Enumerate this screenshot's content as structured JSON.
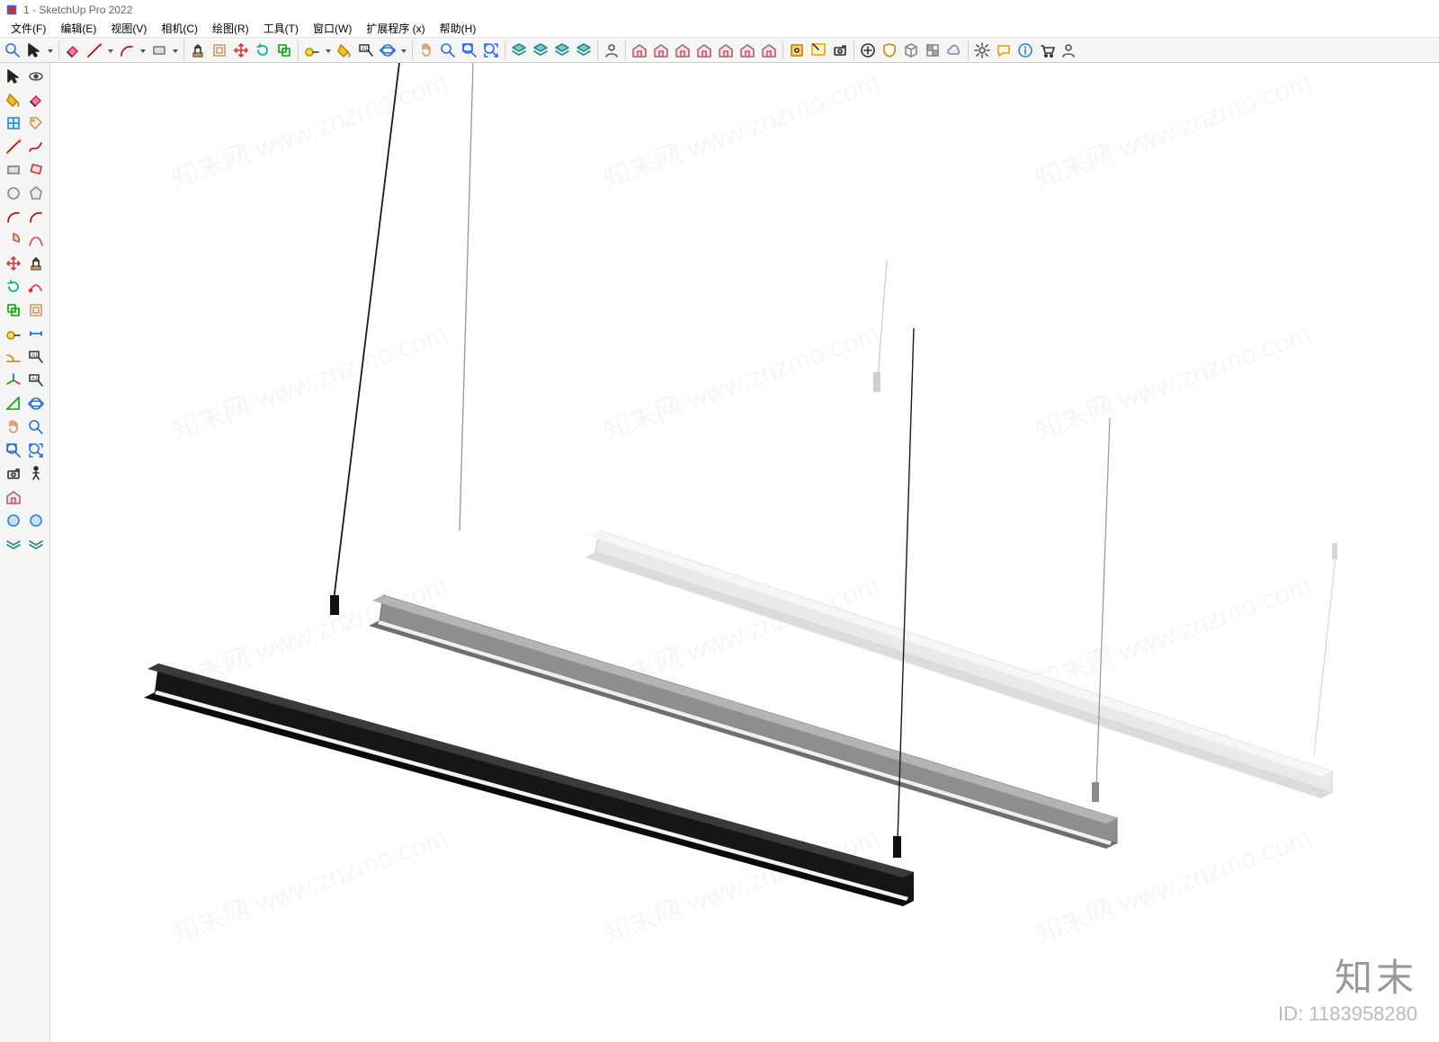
{
  "title": "1 - SketchUp Pro 2022",
  "menus": [
    {
      "label": "文件(F)"
    },
    {
      "label": "编辑(E)"
    },
    {
      "label": "视图(V)"
    },
    {
      "label": "相机(C)"
    },
    {
      "label": "绘图(R)"
    },
    {
      "label": "工具(T)"
    },
    {
      "label": "窗口(W)"
    },
    {
      "label": "扩展程序 (x)"
    },
    {
      "label": "帮助(H)"
    }
  ],
  "watermark": {
    "brand_cn": "知末",
    "id_label": "ID: 1183958280"
  },
  "toolbar_top": [
    {
      "name": "zoom-icon",
      "group": 0
    },
    {
      "name": "select-arrow-icon",
      "group": 0
    },
    {
      "name": "dropdown-icon",
      "group": 0
    },
    {
      "name": "eraser-icon",
      "group": 1
    },
    {
      "name": "pencil-icon",
      "group": 1
    },
    {
      "name": "dropdown-icon",
      "group": 1
    },
    {
      "name": "arc-icon",
      "group": 1
    },
    {
      "name": "dropdown-icon",
      "group": 1
    },
    {
      "name": "rectangle-icon",
      "group": 1
    },
    {
      "name": "dropdown-icon",
      "group": 1
    },
    {
      "name": "pushpull-icon",
      "group": 2
    },
    {
      "name": "offset-icon",
      "group": 2
    },
    {
      "name": "move-icon",
      "group": 2
    },
    {
      "name": "rotate-icon",
      "group": 2
    },
    {
      "name": "scale-icon",
      "group": 2
    },
    {
      "name": "tape-icon",
      "group": 3
    },
    {
      "name": "dropdown-icon",
      "group": 3
    },
    {
      "name": "paint-icon",
      "group": 3
    },
    {
      "name": "text-icon",
      "group": 3
    },
    {
      "name": "orbit-icon",
      "group": 3
    },
    {
      "name": "dropdown-icon",
      "group": 3
    },
    {
      "name": "pan-icon",
      "group": 4
    },
    {
      "name": "zoom-tool-icon",
      "group": 4
    },
    {
      "name": "zoom-window-icon",
      "group": 4
    },
    {
      "name": "zoom-extents-icon",
      "group": 4
    },
    {
      "name": "layers-icon",
      "group": 5
    },
    {
      "name": "tags-icon",
      "group": 5
    },
    {
      "name": "outliner-icon",
      "group": 5
    },
    {
      "name": "scenes-icon",
      "group": 5
    },
    {
      "name": "user-icon",
      "group": 6
    },
    {
      "name": "warehouse-icon",
      "group": 7
    },
    {
      "name": "3dwarehouse-icon",
      "group": 7
    },
    {
      "name": "home-icon",
      "group": 7
    },
    {
      "name": "print-icon",
      "group": 7
    },
    {
      "name": "house-icon",
      "group": 7
    },
    {
      "name": "export-icon",
      "group": 7
    },
    {
      "name": "box-icon",
      "group": 7
    },
    {
      "name": "extension-icon",
      "group": 8
    },
    {
      "name": "select-window-icon",
      "group": 8
    },
    {
      "name": "camera-tool-icon",
      "group": 8
    },
    {
      "name": "add-icon",
      "group": 9
    },
    {
      "name": "shield-icon",
      "group": 9
    },
    {
      "name": "cube-icon",
      "group": 9
    },
    {
      "name": "transparency-icon",
      "group": 9
    },
    {
      "name": "cloud-icon",
      "group": 9
    },
    {
      "name": "gear-icon",
      "group": 10
    },
    {
      "name": "chat-icon",
      "group": 10
    },
    {
      "name": "info-icon",
      "group": 10
    },
    {
      "name": "cart-icon",
      "group": 10
    },
    {
      "name": "profile-icon",
      "group": 10
    }
  ],
  "sidebar": [
    [
      "select-icon",
      "look-icon"
    ],
    [
      "paint-bucket-icon",
      "eraser-icon"
    ],
    [
      "component-icon",
      "tag-apply-icon"
    ],
    [
      "line-icon",
      "freehand-icon"
    ],
    [
      "rectangle-tool-icon",
      "rectangle-rot-icon"
    ],
    [
      "circle-icon",
      "polygon-icon"
    ],
    [
      "arc2-icon",
      "arc3-icon"
    ],
    [
      "pie-icon",
      "bezier-icon"
    ],
    [
      "move-tool-icon",
      "pushpull-tool-icon"
    ],
    [
      "rotate-tool-icon",
      "followme-icon"
    ],
    [
      "scale-tool-icon",
      "offset-tool-icon"
    ],
    [
      "tape-tool-icon",
      "dimension-icon"
    ],
    [
      "protractor-icon",
      "text-label-icon"
    ],
    [
      "axes-icon",
      "3dtext-icon"
    ],
    [
      "section-icon",
      "orbit-tool-icon"
    ],
    [
      "pan-tool-icon",
      "zoom-tool2-icon"
    ],
    [
      "zoom-window2-icon",
      "zoom-extents2-icon"
    ],
    [
      "position-camera-icon",
      "walk-icon"
    ],
    [
      "footprint-icon",
      "blank-icon"
    ],
    [
      "plugin1-icon",
      "plugin2-icon"
    ],
    [
      "plugin3-icon",
      "plugin4-icon"
    ]
  ]
}
